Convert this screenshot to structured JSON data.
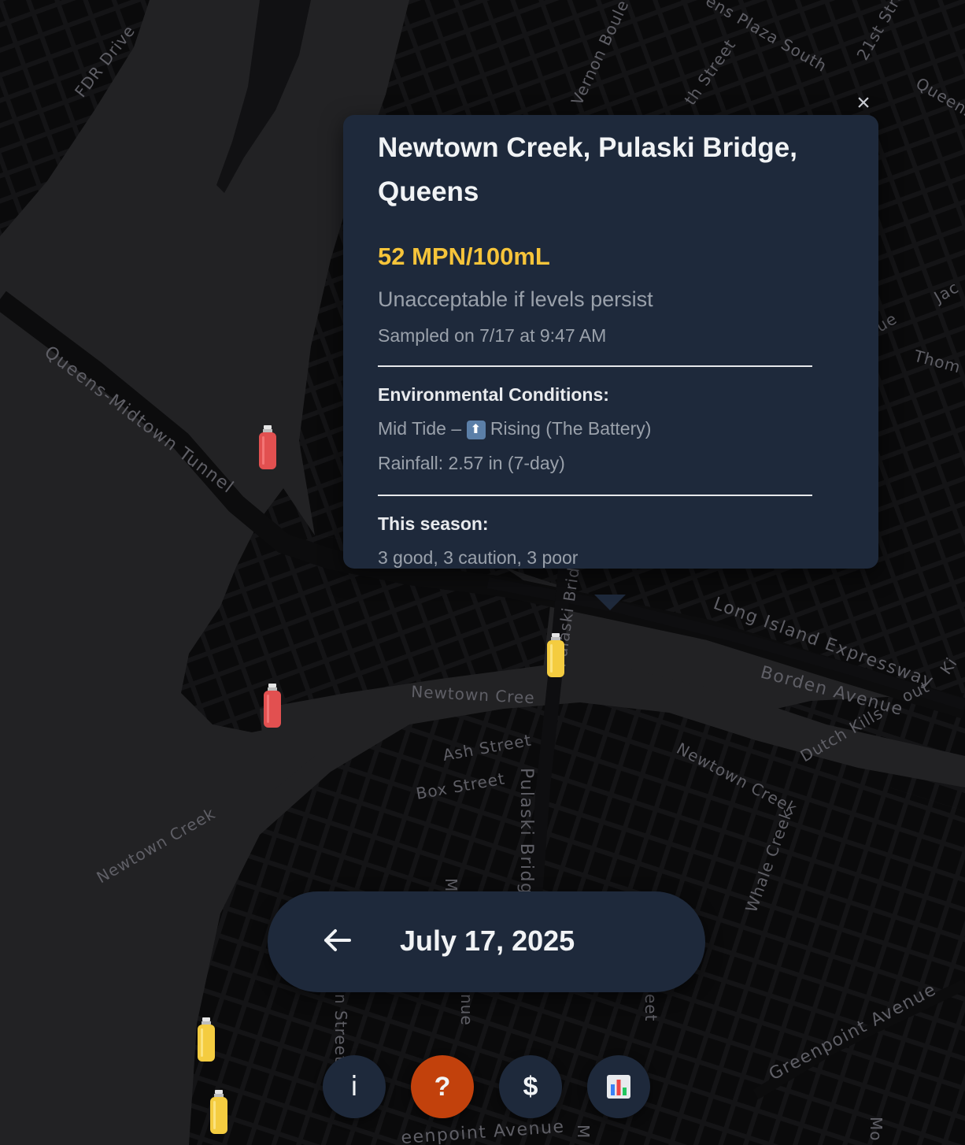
{
  "map": {
    "labels": {
      "fdr_drive": "FDR Drive",
      "vernon_blvd": "Vernon Boule",
      "plaza_south": "ens Plaza South",
      "street_21": "21st Stre",
      "queens_top": "Queens",
      "th_street": "th Street",
      "jackson": "Jac",
      "ue": "ue",
      "thomson": "Thom",
      "midtown_tunnel": "Queens-Midtown Tunnel",
      "lie": "Long Island Expressway",
      "ki": "Ki",
      "borden": "Borden Avenue",
      "borden_suffix": "out",
      "newtown_creek_upper": "Newtown Cree",
      "pulaski_bridge_upper": "Pulaski Bridg",
      "dutch_kills": "Dutch Kills",
      "ash_street": "Ash Street",
      "box_street": "Box Street",
      "pulaski_bridge_lower": "Pulaski Bridg",
      "newtown_creek_right": "Newtown Creek",
      "whale_creek": "Whale Creek",
      "newtown_creek_left": "Newtown Creek",
      "m_street": "M",
      "street_bottom": "n Street",
      "nue": "nue",
      "eet": "eet",
      "greenpoint_avenue_right": "Greenpoint Avenue",
      "greenpoint_avenue_bottom": "eenpoint Avenue",
      "mo": "Mo",
      "m_bottom": "M"
    },
    "markers": [
      {
        "name": "marker-red-1",
        "status": "poor",
        "color": "#e25050"
      },
      {
        "name": "marker-red-2",
        "status": "poor",
        "color": "#e25050"
      },
      {
        "name": "marker-yellow-selected",
        "status": "caution",
        "color": "#f4cc40"
      },
      {
        "name": "marker-yellow-1",
        "status": "caution",
        "color": "#f4cc40"
      },
      {
        "name": "marker-yellow-2",
        "status": "caution",
        "color": "#f4cc40"
      }
    ]
  },
  "popup": {
    "title": "Newtown Creek, Pulaski Bridge, Queens",
    "value": "52 MPN/100mL",
    "status": "Unacceptable if levels persist",
    "sampled": "Sampled on 7/17 at 9:47 AM",
    "env_heading": "Environmental Conditions:",
    "tide_prefix": "Mid Tide –",
    "tide_icon": "⬆",
    "tide_suffix": "Rising (The Battery)",
    "rainfall": "Rainfall: 2.57 in (7-day)",
    "season_heading": "This season:",
    "season_summary": "3 good, 3 caution, 3 poor",
    "close_icon": "×",
    "colors": {
      "value": "#f6c43a",
      "background": "#1e293b"
    }
  },
  "date_bar": {
    "back_icon": "arrow-left-icon",
    "date": "July 17, 2025"
  },
  "buttons": {
    "info": "i",
    "help": "?",
    "donate": "$",
    "stats_icon": "bar-chart-icon",
    "help_color": "#c2410c"
  }
}
